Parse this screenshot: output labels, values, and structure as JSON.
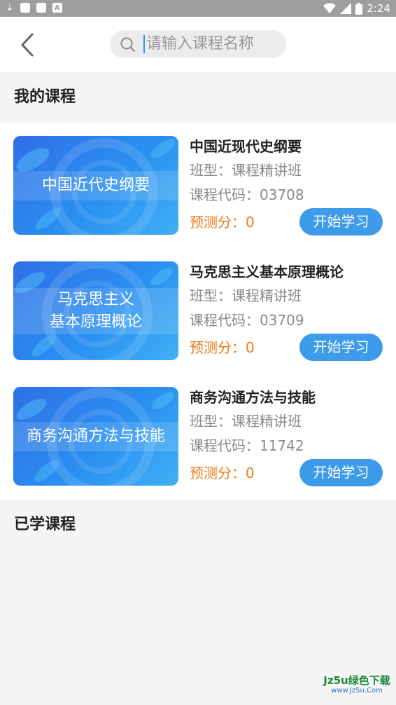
{
  "status_bar": {
    "time": "2:24",
    "left_icons": [
      "download-icon",
      "notification-icon",
      "notification-icon",
      "app-a-icon"
    ],
    "right_icons": [
      "wifi-icon",
      "signal-icon",
      "battery-icon"
    ]
  },
  "header": {
    "back_icon": "chevron-left-icon",
    "search": {
      "icon": "search-icon",
      "placeholder": "请输入课程名称"
    }
  },
  "my_courses": {
    "title": "我的课程",
    "items": [
      {
        "thumb_title": "中国近代史纲要",
        "name": "中国近现代史纲要",
        "class_type": "班型：课程精讲班",
        "code": "课程代码：03708",
        "predicted_score": "预测分：0",
        "button": "开始学习"
      },
      {
        "thumb_title_line1": "马克思主义",
        "thumb_title_line2": "基本原理概论",
        "name": "马克思主义基本原理概论",
        "class_type": "班型：课程精讲班",
        "code": "课程代码：03709",
        "predicted_score": "预测分：0",
        "button": "开始学习"
      },
      {
        "thumb_title": "商务沟通方法与技能",
        "name": "商务沟通方法与技能",
        "class_type": "班型：课程精讲班",
        "code": "课程代码：11742",
        "predicted_score": "预测分：0",
        "button": "开始学习"
      }
    ]
  },
  "learned_courses": {
    "title": "已学课程"
  },
  "watermark": {
    "line1": "Jz5u绿色下载",
    "line2": "www.Jz5u.Com"
  },
  "colors": {
    "accent_blue": "#3d9be9",
    "score_orange": "#f07a1a",
    "status_bar": "#9e9e9e"
  }
}
